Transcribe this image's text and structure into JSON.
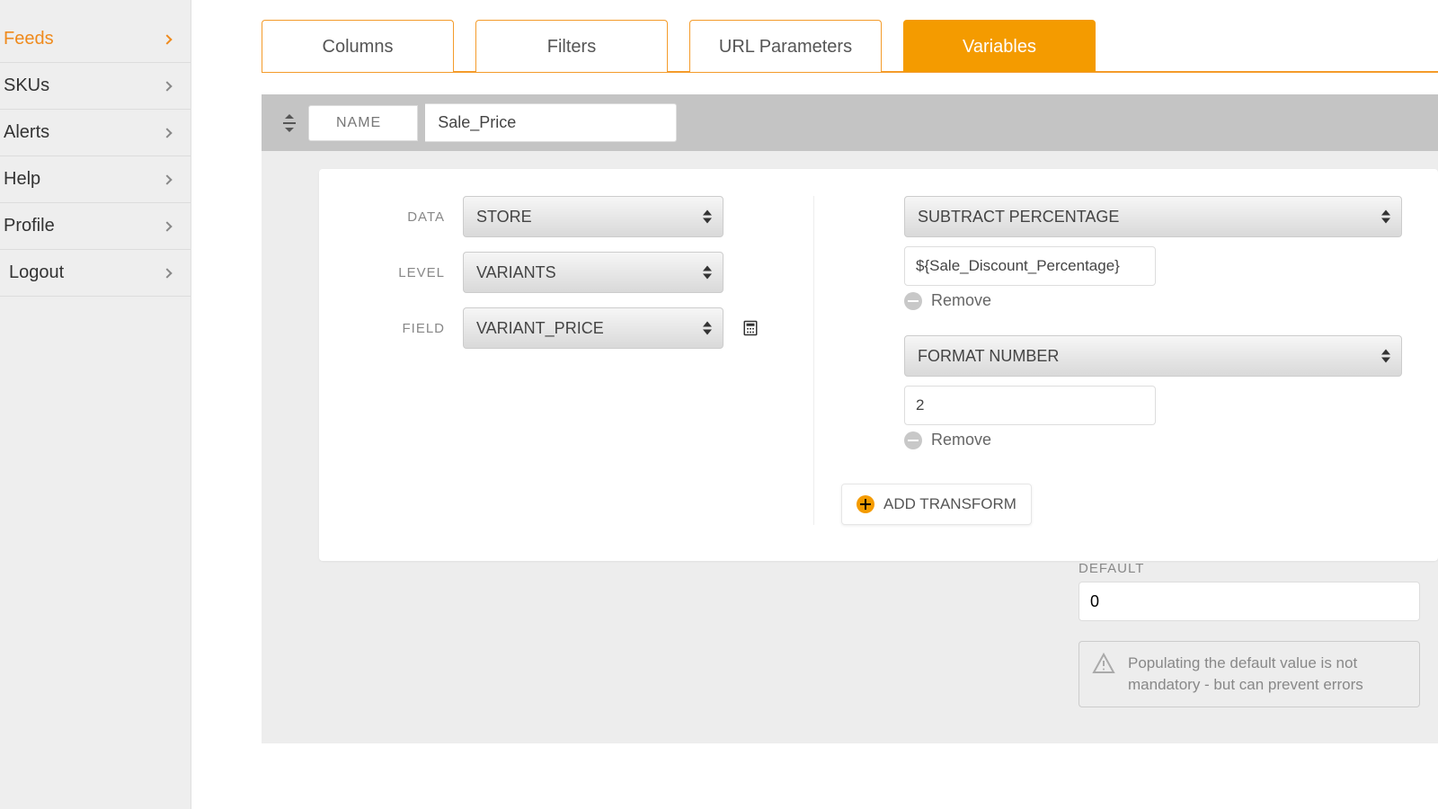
{
  "sidebar": {
    "items": [
      {
        "label": "Feeds",
        "active": true
      },
      {
        "label": "SKUs",
        "active": false
      },
      {
        "label": "Alerts",
        "active": false
      },
      {
        "label": "Help",
        "active": false
      },
      {
        "label": "Profile",
        "active": false
      },
      {
        "label": "Logout",
        "active": false
      }
    ]
  },
  "tabs": [
    {
      "label": "Columns",
      "active": false
    },
    {
      "label": "Filters",
      "active": false
    },
    {
      "label": "URL Parameters",
      "active": false
    },
    {
      "label": "Variables",
      "active": true
    }
  ],
  "variable": {
    "name_label": "NAME",
    "name_value": "Sale_Price",
    "fields": {
      "data": {
        "label": "DATA",
        "value": "STORE"
      },
      "level": {
        "label": "LEVEL",
        "value": "VARIANTS"
      },
      "field": {
        "label": "FIELD",
        "value": "VARIANT_PRICE"
      }
    },
    "transforms": [
      {
        "type": "SUBTRACT PERCENTAGE",
        "value": "${Sale_Discount_Percentage}"
      },
      {
        "type": "FORMAT NUMBER",
        "value": "2"
      }
    ],
    "remove_label": "Remove",
    "add_transform_label": "ADD TRANSFORM",
    "default": {
      "label": "DEFAULT",
      "value": "0",
      "hint": "Populating the default value is not mandatory - but can prevent errors"
    }
  }
}
